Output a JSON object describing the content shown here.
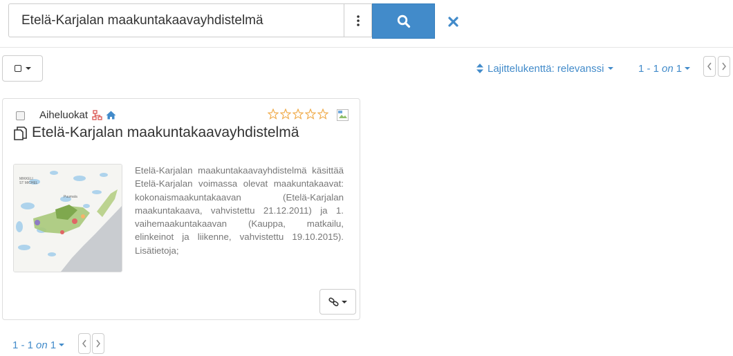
{
  "search": {
    "value": "Etelä-Karjalan maakuntakaavayhdistelmä",
    "more_icon": "vertical-ellipsis-icon",
    "search_icon": "search-icon",
    "clear_icon": "close-icon"
  },
  "toolbar": {
    "select_all_icon": "checkbox-icon",
    "sort_label": "Lajittelukenttä: relevanssi",
    "pager": {
      "range": "1 - 1",
      "of_word": "on",
      "total": "1"
    }
  },
  "results": [
    {
      "category_label": "Aiheluokat",
      "category_icons": [
        "sitemap-icon",
        "home-icon"
      ],
      "rating": 0,
      "rating_max": 5,
      "type_icon": "copy-icon",
      "title": "Etelä-Karjalan maakuntakaavayhdistelmä",
      "description": "Etelä-Karjalan maakuntakaavayhdistelmä käsittää Etelä-Karjalan voimassa olevat maakuntakaavat: kokonaismaakuntakaavan (Etelä-Karjalan maakuntakaava, vahvistettu 21.12.2011) ja 1. vaihemaakuntakaavan (Kauppa, matkailu, elinkeinot ja liikenne, vahvistettu 19.10.2015). Lisätietoja;",
      "thumbnail_icon": "map-thumbnail",
      "links_icon": "link-icon"
    }
  ],
  "footer_pager": {
    "range": "1 - 1",
    "of_word": "on",
    "total": "1"
  },
  "colors": {
    "primary": "#428bca",
    "star": "#f0ad4e",
    "danger": "#d9534f"
  }
}
